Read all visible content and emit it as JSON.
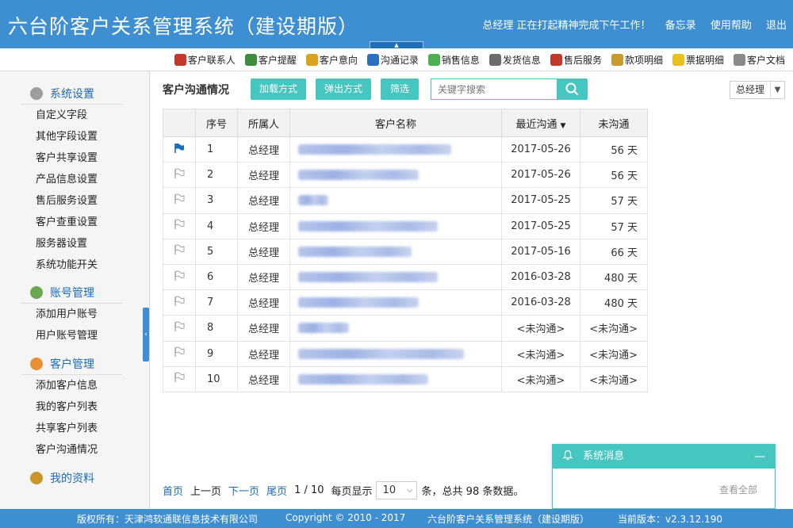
{
  "header": {
    "app_title": "六台阶客户关系管理系统（建设期版）",
    "status": "总经理 正在打起精神完成下午工作！",
    "memo": "备忘录",
    "help": "使用帮助",
    "logout": "退出",
    "collapse_glyph": "▲"
  },
  "toolbar": {
    "items": [
      {
        "label": "客户联系人",
        "icon": "contact-person-icon",
        "color": "#c0392b"
      },
      {
        "label": "客户提醒",
        "icon": "alarm-clock-icon",
        "color": "#3c8d3c"
      },
      {
        "label": "客户意向",
        "icon": "person-intent-icon",
        "color": "#d9a320"
      },
      {
        "label": "沟通记录",
        "icon": "telephone-icon",
        "color": "#2a6fc1"
      },
      {
        "label": "销售信息",
        "icon": "sales-plant-icon",
        "color": "#4caf50"
      },
      {
        "label": "发货信息",
        "icon": "truck-icon",
        "color": "#6d6d6d"
      },
      {
        "label": "售后服务",
        "icon": "service-person-icon",
        "color": "#c0392b"
      },
      {
        "label": "款项明细",
        "icon": "coins-icon",
        "color": "#c89b2b"
      },
      {
        "label": "票据明细",
        "icon": "note-icon",
        "color": "#e8c21c"
      },
      {
        "label": "客户文档",
        "icon": "document-icon",
        "color": "#8a8a8a"
      }
    ]
  },
  "sidebar": {
    "groups": [
      {
        "title": "系统设置",
        "icon": "gear-icon",
        "color": "#9e9e9e",
        "items": [
          "自定义字段",
          "其他字段设置",
          "客户共享设置",
          "产品信息设置",
          "售后服务设置",
          "客户查重设置",
          "服务器设置",
          "系统功能开关"
        ]
      },
      {
        "title": "账号管理",
        "icon": "user-account-icon",
        "color": "#6aa84f",
        "items": [
          "添加用户账号",
          "用户账号管理"
        ]
      },
      {
        "title": "客户管理",
        "icon": "customer-icon",
        "color": "#e69138",
        "items": [
          "添加客户信息",
          "我的客户列表",
          "共享客户列表",
          "客户沟通情况"
        ]
      },
      {
        "title": "我的资料",
        "icon": "briefcase-icon",
        "color": "#c9962a",
        "items": []
      }
    ],
    "toggle_glyph": "‹"
  },
  "main": {
    "title": "客户沟通情况",
    "btn_load": "加载方式",
    "btn_popup": "弹出方式",
    "btn_filter": "筛选",
    "search_placeholder": "关键字搜索",
    "user_filter": "总经理",
    "table": {
      "headers": {
        "no": "序号",
        "owner": "所属人",
        "name": "客户名称",
        "last": "最近沟通",
        "since": "未沟通"
      },
      "sort_glyph": "▼",
      "rows": [
        {
          "no": "1",
          "owner": "总经理",
          "last": "2017-05-26",
          "since": "56 天",
          "flag": "blue-flag-icon",
          "redacted_width": 0.81
        },
        {
          "no": "2",
          "owner": "总经理",
          "last": "2017-05-26",
          "since": "56 天",
          "flag": "flag-outline-icon",
          "redacted_width": 0.64
        },
        {
          "no": "3",
          "owner": "总经理",
          "last": "2017-05-25",
          "since": "57 天",
          "flag": "flag-outline-icon",
          "redacted_width": 0.16
        },
        {
          "no": "4",
          "owner": "总经理",
          "last": "2017-05-25",
          "since": "57 天",
          "flag": "flag-outline-icon",
          "redacted_width": 0.74
        },
        {
          "no": "5",
          "owner": "总经理",
          "last": "2017-05-16",
          "since": "66 天",
          "flag": "flag-outline-icon",
          "redacted_width": 0.6
        },
        {
          "no": "6",
          "owner": "总经理",
          "last": "2016-03-28",
          "since": "480 天",
          "flag": "flag-outline-icon",
          "redacted_width": 0.74
        },
        {
          "no": "7",
          "owner": "总经理",
          "last": "2016-03-28",
          "since": "480 天",
          "flag": "flag-outline-icon",
          "redacted_width": 0.64
        },
        {
          "no": "8",
          "owner": "总经理",
          "last": "<未沟通>",
          "since": "<未沟通>",
          "flag": "flag-outline-icon",
          "redacted_width": 0.27
        },
        {
          "no": "9",
          "owner": "总经理",
          "last": "<未沟通>",
          "since": "<未沟通>",
          "flag": "flag-outline-icon",
          "redacted_width": 0.88
        },
        {
          "no": "10",
          "owner": "总经理",
          "last": "<未沟通>",
          "since": "<未沟通>",
          "flag": "flag-outline-icon",
          "redacted_width": 0.69
        }
      ]
    },
    "pager": {
      "first": "首页",
      "prev": "上一页",
      "next": "下一页",
      "last": "尾页",
      "page_info": "1 / 10",
      "per_page_label": "每页显示",
      "per_page": "10",
      "total": "条，总共 98 条数据。"
    }
  },
  "notification": {
    "title": "系统消息",
    "minimize": "—",
    "view_all": "查看全部"
  },
  "footer": {
    "copyright_owner": "版权所有：天津鸿软通联信息技术有限公司",
    "copyright": "Copyright © 2010 - 2017",
    "product": "六台阶客户关系管理系统（建设期版）",
    "version": "当前版本：v2.3.12.190"
  }
}
